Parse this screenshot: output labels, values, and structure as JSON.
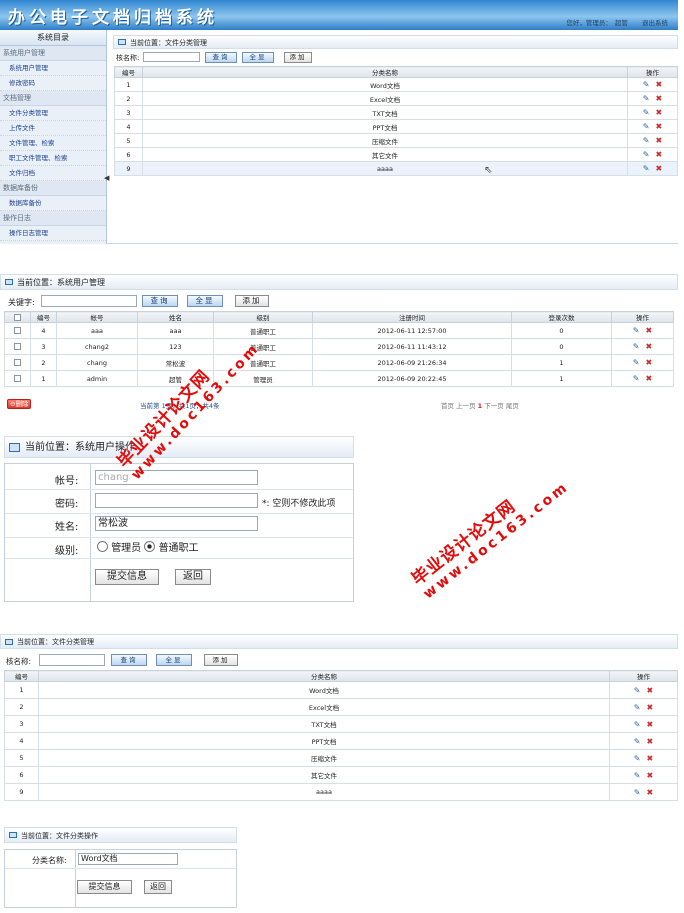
{
  "app": {
    "title": "办公电子文档归档系统",
    "greeting": "您好，管理员：",
    "username": "超管",
    "logout": "退出系统"
  },
  "sidebar": {
    "title": "系统目录",
    "groups": [
      {
        "label": "系统用户管理",
        "items": [
          "系统用户管理",
          "修改密码"
        ]
      },
      {
        "label": "文档管理",
        "items": [
          "文件分类管理",
          "上传文件",
          "文件管理、检索",
          "职工文件管理、检索",
          "文件归档"
        ]
      },
      {
        "label": "数据库备份",
        "items": [
          "数据库备份"
        ]
      },
      {
        "label": "操作日志",
        "items": [
          "操作日志管理"
        ]
      }
    ]
  },
  "panel_category": {
    "breadcrumb": "当前位置：文件分类管理",
    "search_label": "核名称:",
    "search_label_2": "核名称:",
    "query_btn": "查询",
    "show_all_btn": "全显",
    "add_btn": "添加",
    "columns": [
      "编号",
      "分类名称",
      "操作"
    ],
    "rows": [
      {
        "id": "1",
        "name": "Word文档"
      },
      {
        "id": "2",
        "name": "Excel文档"
      },
      {
        "id": "3",
        "name": "TXT文档"
      },
      {
        "id": "4",
        "name": "PPT文档"
      },
      {
        "id": "5",
        "name": "压缩文件"
      },
      {
        "id": "6",
        "name": "其它文件"
      },
      {
        "id": "9",
        "name": "aaaa"
      }
    ]
  },
  "panel_users": {
    "breadcrumb": "当前位置：系统用户管理",
    "search_label": "关键字:",
    "query_btn": "查询",
    "show_all_btn": "全显",
    "add_btn": "添加",
    "columns": [
      "",
      "编号",
      "帐号",
      "姓名",
      "级别",
      "注册时间",
      "登录次数",
      "操作"
    ],
    "rows": [
      {
        "id": "4",
        "account": "aaa",
        "name": "aaa",
        "level": "普通职工",
        "reg_time": "2012-06-11 12:57:00",
        "logins": "0"
      },
      {
        "id": "3",
        "account": "chang2",
        "name": "123",
        "level": "普通职工",
        "reg_time": "2012-06-11 11:43:12",
        "logins": "0"
      },
      {
        "id": "2",
        "account": "chang",
        "name": "常松波",
        "level": "普通职工",
        "reg_time": "2012-06-09 21:26:34",
        "logins": "1"
      },
      {
        "id": "1",
        "account": "admin",
        "name": "超管",
        "level": "管理员",
        "reg_time": "2012-06-09 20:22:45",
        "logins": "1"
      }
    ],
    "delete_btn": "删除",
    "paging_info": "当前第 1页，共1页，共4条",
    "pager": {
      "first": "首页",
      "prev": "上一页",
      "current": "1",
      "next": "下一页",
      "last": "尾页"
    }
  },
  "panel_user_form": {
    "breadcrumb": "当前位置：系统用户操作",
    "account_label": "帐号:",
    "account_value": "chang",
    "password_label": "密码:",
    "password_hint": "*: 空则不修改此项",
    "name_label": "姓名:",
    "name_value": "常松波",
    "level_label": "级别:",
    "level_options": [
      "管理员",
      "普通职工"
    ],
    "level_selected": "普通职工",
    "submit_btn": "提交信息",
    "back_btn": "返回"
  },
  "panel_category_form": {
    "breadcrumb": "当前位置：文件分类操作",
    "name_label": "分类名称:",
    "name_value": "Word文档",
    "submit_btn": "提交信息",
    "back_btn": "返回"
  },
  "watermark": {
    "cn": "毕业设计论文网",
    "url": "www.doc163.com"
  },
  "colors": {
    "header_blue": "#2f86cf",
    "link_blue": "#1c3f8c",
    "delete_red": "#cc2b2b",
    "watermark_red": "#e40a0a"
  }
}
